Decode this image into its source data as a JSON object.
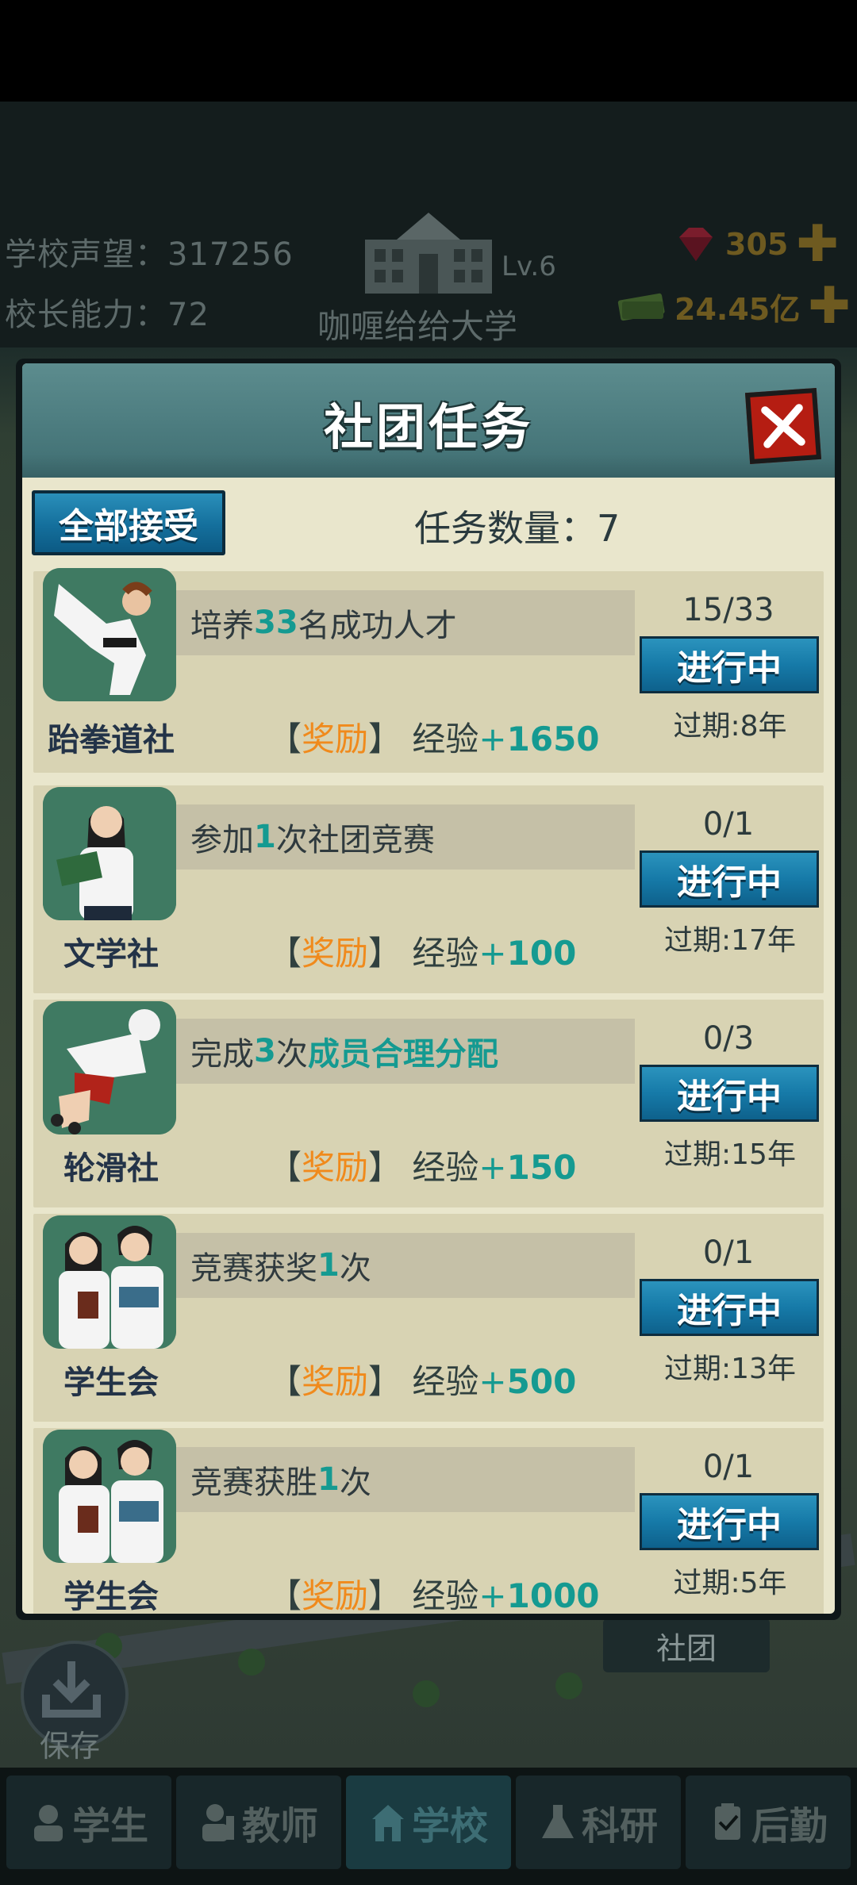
{
  "header": {
    "reputation_label": "学校声望：",
    "reputation_value": "317256",
    "ability_label": "校长能力：",
    "ability_value": "72",
    "level": "Lv.6",
    "school_name": "咖喱给给大学",
    "gems": "305",
    "money": "24.45亿"
  },
  "map": {
    "club_sign": "社团",
    "save_label": "保存"
  },
  "dialog": {
    "title": "社团任务",
    "accept_all": "全部接受",
    "task_count_label": "任务数量：",
    "task_count": "7",
    "reward_tag": "奖励",
    "reward_exp_label": "经验",
    "tasks": [
      {
        "club": "跆拳道社",
        "pre": "培养",
        "num": "33",
        "post": "名成功人才",
        "hl": "",
        "reward": "1650",
        "progress": "15/33",
        "status": "进行中",
        "expire": "过期:8年",
        "avatar": "taekwondo-icon"
      },
      {
        "club": "文学社",
        "pre": "参加",
        "num": "1",
        "post": "次社团竞赛",
        "hl": "",
        "reward": "100",
        "progress": "0/1",
        "status": "进行中",
        "expire": "过期:17年",
        "avatar": "reader-icon"
      },
      {
        "club": "轮滑社",
        "pre": "完成",
        "num": "3",
        "post": "次",
        "hl": "成员合理分配",
        "reward": "150",
        "progress": "0/3",
        "status": "进行中",
        "expire": "过期:15年",
        "avatar": "skater-icon"
      },
      {
        "club": "学生会",
        "pre": "竞赛获奖",
        "num": "1",
        "post": "次",
        "hl": "",
        "reward": "500",
        "progress": "0/1",
        "status": "进行中",
        "expire": "过期:13年",
        "avatar": "students-icon"
      },
      {
        "club": "学生会",
        "pre": "竞赛获胜",
        "num": "1",
        "post": "次",
        "hl": "",
        "reward": "1000",
        "progress": "0/1",
        "status": "进行中",
        "expire": "过期:5年",
        "avatar": "students-icon"
      }
    ]
  },
  "nav": [
    {
      "label": "学生",
      "icon": "student-icon"
    },
    {
      "label": "教师",
      "icon": "teacher-icon"
    },
    {
      "label": "学校",
      "icon": "school-icon"
    },
    {
      "label": "科研",
      "icon": "research-icon"
    },
    {
      "label": "后勤",
      "icon": "logistics-icon"
    }
  ],
  "colors": {
    "accent_teal": "#159a91",
    "reward_orange": "#f08a1c",
    "button_blue": "#167aa8",
    "close_red": "#b51d12"
  }
}
